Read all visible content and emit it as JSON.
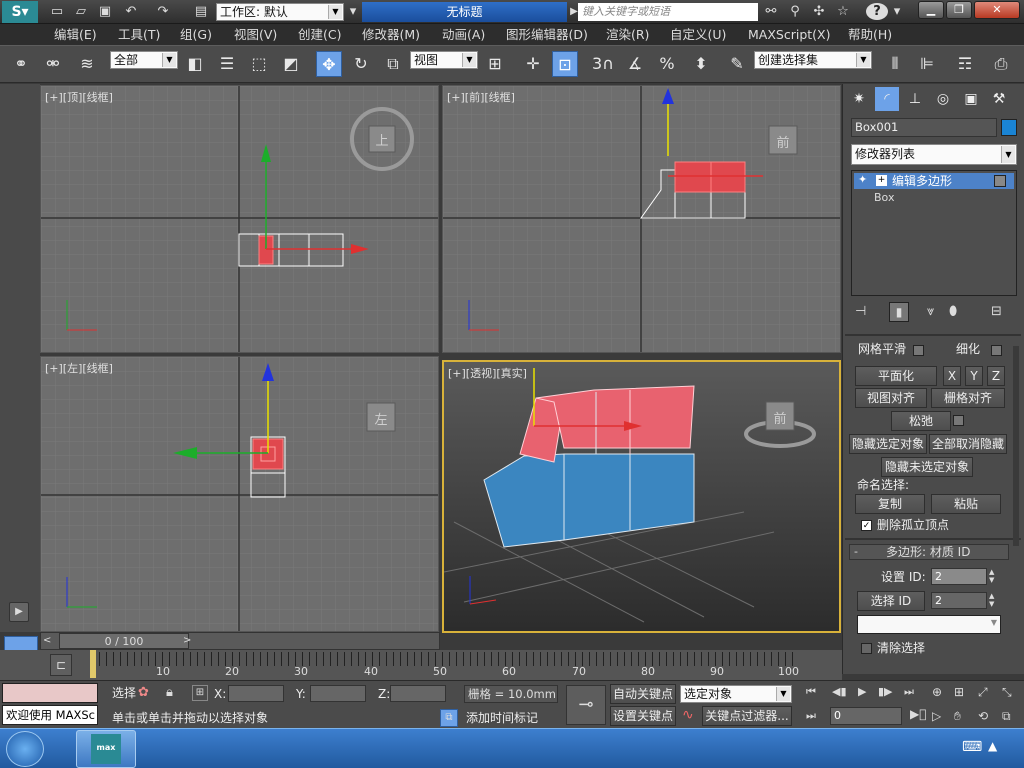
{
  "titlebar": {
    "workspace_label": "工作区: 默认",
    "doc_title": "无标题",
    "search_placeholder": "键入关键字或短语"
  },
  "menu": [
    "编辑(E)",
    "工具(T)",
    "组(G)",
    "视图(V)",
    "创建(C)",
    "修改器(M)",
    "动画(A)",
    "图形编辑器(D)",
    "渲染(R)",
    "自定义(U)",
    "MAXScript(X)",
    "帮助(H)"
  ],
  "toolbar": {
    "filter_value": "全部",
    "ref_coord_value": "视图",
    "snap_value": "3",
    "named_selection_placeholder": "创建选择集",
    "percent_snap": "%"
  },
  "viewports": {
    "top_label": "[+][顶][线框]",
    "front_label": "[+][前][线框]",
    "left_label": "[+][左][线框]",
    "persp_label": "[+][透视][真实]",
    "cube_top": "上",
    "cube_front": "前",
    "cube_left": "左",
    "cube_persp": "前"
  },
  "cmdpanel": {
    "object_name": "Box001",
    "modifier_list": "修改器列表",
    "stack_items": [
      "编辑多边形",
      "Box"
    ],
    "btn_mesh_smooth": "网格平滑",
    "btn_refine": "细化",
    "btn_planarize": "平面化",
    "btn_x": "X",
    "btn_y": "Y",
    "btn_z": "Z",
    "btn_view_align": "视图对齐",
    "btn_grid_align": "栅格对齐",
    "btn_relax": "松弛",
    "btn_hide_selected": "隐藏选定对象",
    "btn_unhide_all": "全部取消隐藏",
    "btn_hide_unselected": "隐藏未选定对象",
    "named_selection_label": "命名选择:",
    "btn_copy": "复制",
    "btn_paste": "粘贴",
    "delete_isolated_label": "删除孤立顶点",
    "rollout_minus": "-",
    "rollout_title": "多边形: 材质 ID",
    "set_id_label": "设置 ID:",
    "set_id_value": "2",
    "select_id_label": "选择 ID",
    "select_id_value": "2",
    "clear_selection_label": "清除选择"
  },
  "timeline": {
    "frame_display": "0 / 100",
    "ticks": [
      "10",
      "20",
      "30",
      "40",
      "50",
      "60",
      "70",
      "80",
      "90",
      "100"
    ]
  },
  "status": {
    "welcome": "欢迎使用 MAXSc",
    "selected_short": "选择",
    "x_label": "X:",
    "y_label": "Y:",
    "z_label": "Z:",
    "grid_value": "栅格 = 10.0mm",
    "prompt": "单击或单击并拖动以选择对象",
    "add_time_tag": "添加时间标记",
    "auto_key": "自动关键点",
    "set_key": "设置关键点",
    "selected_object": "选定对象",
    "key_filters": "关键点过滤器...",
    "current_frame": "0"
  },
  "taskbar": {
    "app_label": "max"
  }
}
